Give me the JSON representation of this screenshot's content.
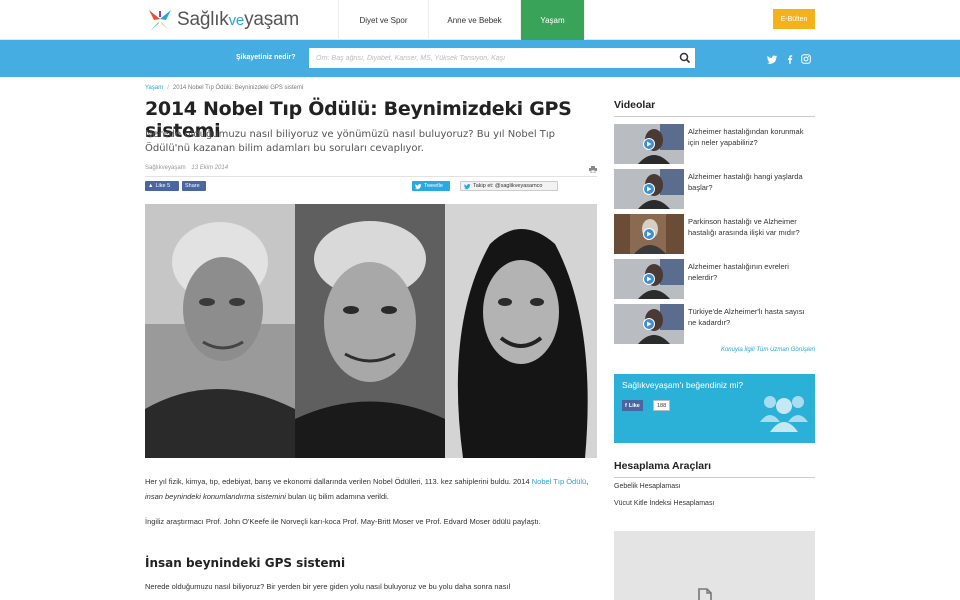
{
  "header": {
    "logo": {
      "main": "Sağlık",
      "ve": "ve",
      "rest": "yaşam"
    },
    "nav": [
      {
        "label": "Diyet ve Spor",
        "active": false
      },
      {
        "label": "Anne ve Bebek",
        "active": false
      },
      {
        "label": "Yaşam",
        "active": true
      },
      {
        "label": "",
        "active": false
      }
    ],
    "ebulten": "E-Bülten",
    "active_color": "#3aa35a",
    "accent_color": "#45ade2",
    "ebulten_color": "#f3b21b"
  },
  "search": {
    "label": "Şikayetiniz nedir?",
    "placeholder": "Örn: Baş ağrısı, Diyabet, Kanser, MS, Yüksek Tansiyon, Kaşı",
    "value": "",
    "icons": [
      "search-icon",
      "twitter-icon",
      "facebook-icon",
      "instagram-icon"
    ]
  },
  "breadcrumb": {
    "section": "Yaşam",
    "current": "2014 Nobel Tıp Ödülü: Beyninizdeki GPS sistemi"
  },
  "article": {
    "title": "2014 Nobel Tıp Ödülü: Beynimizdeki GPS sistemi",
    "lede": "Nerede olduğumuzu nasıl biliyoruz ve yönümüzü nasıl buluyoruz? Bu yıl Nobel Tıp Ödülü'nü kazanan bilim adamları bu soruları cevaplıyor.",
    "author": "Sağlıkveyaşam",
    "date": "13 Ekim 2014",
    "share": {
      "like": "Like 5",
      "share": "Share",
      "tweet": "Tweetle",
      "follow": "Takip et: @saglikveyasamco"
    },
    "paragraph1": {
      "before": "Her yıl fizik, kimya, tıp, edebiyat, barış ve ekonomi dallarında verilen Nobel Ödülleri, 113. kez sahiplerini buldu. 2014 ",
      "link": "Nobel Tıp Ödülü",
      "between": ", ",
      "italic": "insan beynindeki konumlandırma sistemini",
      "after": " bulan üç bilim adamına verildi."
    },
    "paragraph2": "İngiliz araştırmacı Prof. John O'Keefe ile Norveçli karı-koca Prof. May-Britt Moser ve Prof. Edvard Moser ödülü paylaştı.",
    "subheading": "İnsan beynindeki GPS sistemi",
    "paragraph3": "Nerede olduğumuzu nasıl biliyoruz? Bir yerden bir yere giden yolu nasıl buluyoruz ve bu yolu daha sonra nasıl"
  },
  "sidebar": {
    "videos_heading": "Videolar",
    "videos": [
      {
        "title": "Alzheimer hastalığından korunmak için neler yapabiliriz?"
      },
      {
        "title": "Alzheimer hastalığı hangi yaşlarda başlar?"
      },
      {
        "title": "Parkinson hastalığı ve Alzheimer hastalığı arasında ilişki var mıdır?"
      },
      {
        "title": "Alzheimer hastalığının evreleri nelerdir?"
      },
      {
        "title": "Türkiye'de Alzheimer'lı hasta sayısı ne kadardır?"
      }
    ],
    "more_link": "Konuyla İlgili Tüm Uzman Görüşleri",
    "like_box": {
      "title": "Sağlıkveyaşam'ı beğendiniz mi?",
      "button": "Like",
      "count": "188",
      "color": "#2bb1d8"
    },
    "tools_heading": "Hesaplama Araçları",
    "tools": [
      "Gebelik Hesaplaması",
      "Vücut Kitle İndeksi Hesaplaması"
    ]
  }
}
